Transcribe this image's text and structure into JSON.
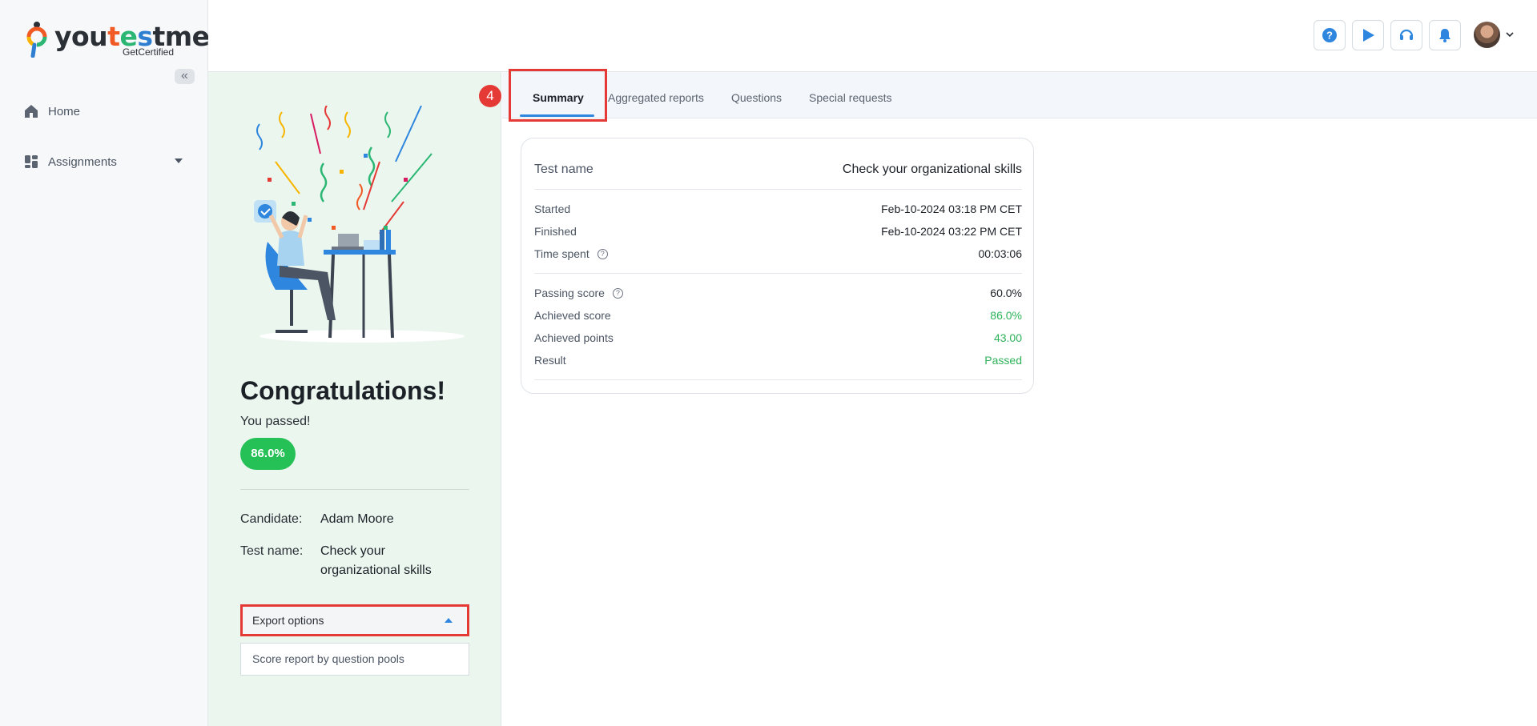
{
  "brand": {
    "name_part1": "you",
    "name_part2": "t",
    "name_part3": "e",
    "name_part4": "s",
    "name_part5": "tme",
    "subtitle": "GetCertified"
  },
  "sidebar": {
    "collapse_icon": "«",
    "items": [
      {
        "label": "Home",
        "icon": "home-icon"
      },
      {
        "label": "Assignments",
        "icon": "dashboard-icon"
      }
    ]
  },
  "header": {
    "buttons": [
      "help-icon",
      "play-icon",
      "headset-icon",
      "bell-icon"
    ],
    "accent": "#2e86de"
  },
  "result": {
    "heading": "Congratulations!",
    "status": "You passed!",
    "score": "86.0%",
    "candidate_label": "Candidate:",
    "candidate_value": "Adam Moore",
    "test_label": "Test name:",
    "test_value": "Check your organizational skills",
    "export_label": "Export options",
    "export_option": "Score report by question pools"
  },
  "tabs": {
    "step_number": "4",
    "items": [
      "Summary",
      "Aggregated reports",
      "Questions",
      "Special requests"
    ],
    "active": "Summary"
  },
  "summary": {
    "title_label": "Test name",
    "title_value": "Check your organizational skills",
    "started_label": "Started",
    "started_value": "Feb-10-2024 03:18 PM CET",
    "finished_label": "Finished",
    "finished_value": "Feb-10-2024 03:22 PM CET",
    "time_label": "Time spent",
    "time_value": "00:03:06",
    "passing_label": "Passing score",
    "passing_value": "60.0%",
    "achieved_label": "Achieved score",
    "achieved_value": "86.0%",
    "points_label": "Achieved points",
    "points_value": "43.00",
    "result_label": "Result",
    "result_value": "Passed",
    "help_glyph": "?"
  },
  "colors": {
    "success": "#25c056",
    "highlight": "#e53935",
    "panel_bg": "#ebf6ef"
  }
}
